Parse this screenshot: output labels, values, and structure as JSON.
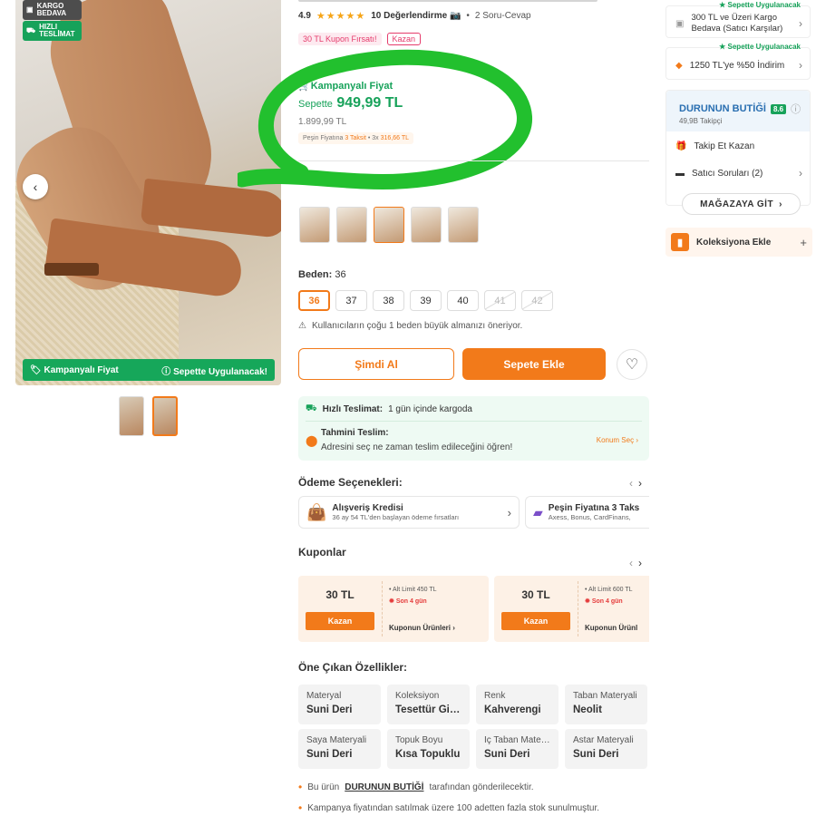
{
  "badges": {
    "kargo": "KARGO BEDAVA",
    "hizli": "HIZLI TESLİMAT"
  },
  "promo_bar": {
    "left": "Kampanyalı Fiyat",
    "right": "Sepette Uygulanacak!"
  },
  "rating": {
    "score": "4.9",
    "stars": "★★★★★",
    "reviews": "10 Değerlendirme",
    "qa": "2 Soru-Cevap"
  },
  "coupon_chip": {
    "text": "30 TL Kupon Fırsatı!",
    "action": "Kazan"
  },
  "campaign": {
    "title": "Kampanyalı Fiyat",
    "prefix": "Sepette",
    "price": "949,99 TL",
    "old_price": "1.899,99 TL",
    "taksit_a": "Peşin Fiyatına",
    "taksit_b": "3 Taksit",
    "taksit_c": "3x",
    "taksit_d": "316,66 TL"
  },
  "size": {
    "label": "Beden:",
    "selected": "36",
    "options": [
      "36",
      "37",
      "38",
      "39",
      "40",
      "41",
      "42"
    ],
    "note": "Kullanıcıların çoğu 1 beden büyük almanızı öneriyor."
  },
  "buttons": {
    "buy_now": "Şimdi Al",
    "add_cart": "Sepete Ekle"
  },
  "shipping": {
    "fast_label": "Hızlı Teslimat:",
    "fast_text": "1 gün içinde kargoda",
    "est_title": "Tahmini Teslim:",
    "est_text": "Adresini seç ne zaman teslim edileceğini öğren!",
    "konum": "Konum Seç"
  },
  "payment": {
    "title": "Ödeme Seçenekleri:",
    "cards": [
      {
        "title": "Alışveriş Kredisi",
        "sub": "36 ay 54 TL'den başlayan ödeme fırsatları"
      },
      {
        "title": "Peşin Fiyatına 3 Taks",
        "sub": "Axess, Bonus, CardFinans,"
      }
    ]
  },
  "coupons": {
    "title": "Kuponlar",
    "items": [
      {
        "amount": "30 TL",
        "action": "Kazan",
        "limit": "Alt Limit 450 TL",
        "days": "Son 4 gün",
        "link": "Kuponun Ürünleri"
      },
      {
        "amount": "30 TL",
        "action": "Kazan",
        "limit": "Alt Limit 600 TL",
        "days": "Son 4 gün",
        "link": "Kuponun Ürünl"
      }
    ]
  },
  "features": {
    "title": "Öne Çıkan Özellikler:",
    "items": [
      {
        "k": "Materyal",
        "v": "Suni Deri"
      },
      {
        "k": "Koleksiyon",
        "v": "Tesettür Giyim"
      },
      {
        "k": "Renk",
        "v": "Kahverengi"
      },
      {
        "k": "Taban Materyali",
        "v": "Neolit"
      },
      {
        "k": "Saya Materyali",
        "v": "Suni Deri"
      },
      {
        "k": "Topuk Boyu",
        "v": "Kısa Topuklu"
      },
      {
        "k": "İç Taban Materyali",
        "v": "Suni Deri"
      },
      {
        "k": "Astar Materyali",
        "v": "Suni Deri"
      }
    ]
  },
  "notes": {
    "n1_a": "Bu ürün",
    "n1_b": "DURUNUN BUTİĞİ",
    "n1_c": "tarafından gönderilecektir.",
    "n2": "Kampanya fiyatından satılmak üzere 100 adetten fazla stok sunulmuştur."
  },
  "side": {
    "tag": "Sepette Uygulanacak",
    "promo1": "300 TL ve Üzeri Kargo Bedava (Satıcı Karşılar)",
    "promo2": "1250 TL'ye %50 İndirim",
    "seller_name": "DURUNUN BUTİĞİ",
    "seller_score": "8.6",
    "followers": "49,9B Takipçi",
    "follow_earn": "Takip Et Kazan",
    "seller_q": "Satıcı Soruları (2)",
    "store_btn": "MAĞAZAYA GİT",
    "collection": "Koleksiyona Ekle"
  },
  "colors": {
    "accent": "#f27a1a",
    "green": "#17a25a",
    "highlight_ring": "#22c02e"
  }
}
